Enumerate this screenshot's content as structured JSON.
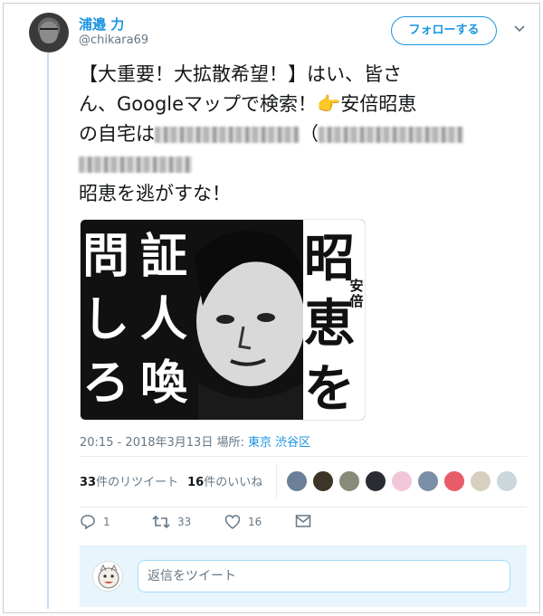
{
  "user": {
    "name": "浦邉 力",
    "handle": "@chikara69"
  },
  "follow_button": {
    "label": "フォローする"
  },
  "tweet": {
    "line1": "【大重要！大拡散希望！】はい、皆さ",
    "line2a": "ん、Googleマップで検索！",
    "pointer": "👉",
    "line2b": "安倍昭恵",
    "line3a": "の自宅は",
    "line3b": "（",
    "line5": "昭恵を逃がすな！"
  },
  "media": {
    "left_col": "問しろ",
    "mid_col": "証人喚",
    "right_big": "昭恵を",
    "right_small": "安倍",
    "ch_left_1": "問",
    "ch_left_2": "し",
    "ch_left_3": "ろ",
    "ch_mid_1": "証",
    "ch_mid_2": "人",
    "ch_mid_3": "喚",
    "ch_right_1": "昭",
    "ch_right_2": "恵",
    "ch_right_3": "を",
    "ch_small_1": "安",
    "ch_small_2": "倍"
  },
  "meta": {
    "timestamp": "20:15 - 2018年3月13日 場所: ",
    "place": "東京 渋谷区"
  },
  "stats": {
    "retweets_count": "33",
    "retweets_label": "件のリツイート",
    "likes_count": "16",
    "likes_label": "件のいいね"
  },
  "actions": {
    "reply_count": "1",
    "retweet_count": "33",
    "like_count": "16"
  },
  "reply": {
    "placeholder": "返信をツイート"
  },
  "colors": {
    "accent": "#1b95e0",
    "secondary_text": "#657786",
    "reply_bg": "#e8f5fd"
  }
}
